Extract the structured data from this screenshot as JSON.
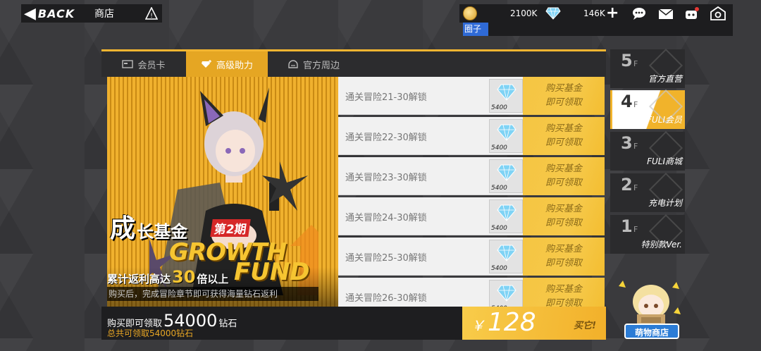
{
  "topbar": {
    "back_label": "BACK",
    "title": "商店",
    "gold": "2100K",
    "gems": "146K",
    "nickname": "圈子"
  },
  "tabs": [
    {
      "label": "会员卡",
      "icon": "card-icon",
      "active": false
    },
    {
      "label": "高级助力",
      "icon": "diamond-plus-icon",
      "active": true
    },
    {
      "label": "官方周边",
      "icon": "helmet-icon",
      "active": false
    }
  ],
  "banner": {
    "title_big": "成",
    "title_rest": "长基金",
    "period": "第2期",
    "growth": "GROWTH",
    "fund": "FUND",
    "rebate_pre": "累计返利高达",
    "rebate_num": "30",
    "rebate_post": "倍以上",
    "note": "购买后，完成冒险章节即可获得海量钻石返利"
  },
  "items": [
    {
      "label": "通关冒险21-30解锁",
      "qty": "5400",
      "claim": "购买基金\n即可领取"
    },
    {
      "label": "通关冒险22-30解锁",
      "qty": "5400",
      "claim": "购买基金\n即可领取"
    },
    {
      "label": "通关冒险23-30解锁",
      "qty": "5400",
      "claim": "购买基金\n即可领取"
    },
    {
      "label": "通关冒险24-30解锁",
      "qty": "5400",
      "claim": "购买基金\n即可领取"
    },
    {
      "label": "通关冒险25-30解锁",
      "qty": "5400",
      "claim": "购买基金\n即可领取"
    },
    {
      "label": "通关冒险26-30解锁",
      "qty": "5400",
      "claim": "购买基金\n即可领取"
    }
  ],
  "footer": {
    "pre": "购买即可领取",
    "amount": "54000",
    "unit": "钻石",
    "total": "总共可领取54000钻石",
    "currency": "￥",
    "price": "128",
    "buy": "买它!"
  },
  "floors": [
    {
      "num": "5",
      "suffix": "F",
      "name": "官方直营",
      "active": false
    },
    {
      "num": "4",
      "suffix": "F",
      "name": "FULI会员",
      "active": true
    },
    {
      "num": "3",
      "suffix": "F",
      "name": "FULI商城",
      "active": false
    },
    {
      "num": "2",
      "suffix": "F",
      "name": "充电计划",
      "active": false
    },
    {
      "num": "1",
      "suffix": "F",
      "name": "特别款Ver.",
      "active": false
    }
  ],
  "mascot_label": "萌物商店",
  "colors": {
    "accent": "#f2b531",
    "tab_active": "#e5a623",
    "nick_tag": "#2f6ad6",
    "period_tag": "#d62828"
  }
}
